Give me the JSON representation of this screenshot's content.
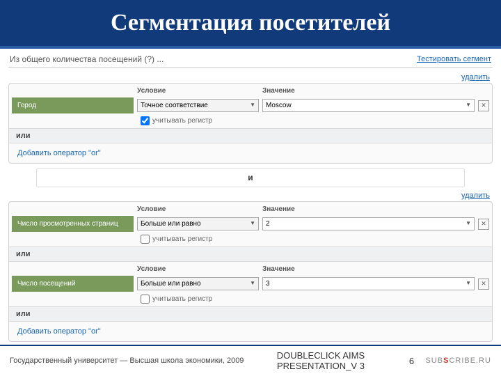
{
  "title": "Сегментация посетителей",
  "header": {
    "total": "Из общего количества посещений (?) ...",
    "test": "Тестировать сегмент",
    "delete": "удалить"
  },
  "labels": {
    "condition": "Условие",
    "value": "Значение",
    "case": "учитывать регистр",
    "or": "или",
    "and": "и",
    "add_or": "Добавить оператор \"or\""
  },
  "rules": {
    "city": {
      "label": "Город",
      "op": "Точное соответствие",
      "val": "Moscow",
      "chk": true
    },
    "pages": {
      "label": "Число просмотренных страниц",
      "op": "Больше или равно",
      "val": "2",
      "chk": false
    },
    "visits": {
      "label": "Число посещений",
      "op": "Больше или равно",
      "val": "3",
      "chk": false
    }
  },
  "footer": {
    "org": "Государственный университет — Высшая школа экономики, 2009",
    "mid1": "DOUBLECLICK AIMS",
    "mid2": "PRESENTATION_V 3",
    "page": "6",
    "logo": "SUBSCRIBE.RU"
  }
}
